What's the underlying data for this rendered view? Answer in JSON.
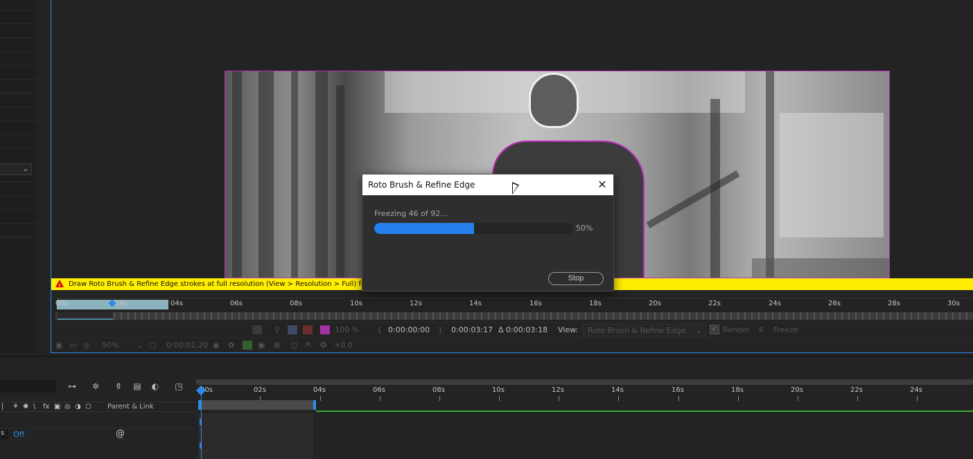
{
  "viewer": {
    "warning_text": "Draw Roto Brush & Refine Edge strokes at full resolution (View > Resolution > Full) for best results.",
    "ruler_labels": [
      "00s",
      "02s",
      "04s",
      "06s",
      "08s",
      "10s",
      "12s",
      "14s",
      "16s",
      "18s",
      "20s",
      "22s",
      "24s",
      "26s",
      "28s",
      "30s"
    ],
    "controls": {
      "opacity": "100 %",
      "time_start": "0:00:00:00",
      "time_end": "0:00:03:17",
      "time_delta": "Δ 0:00:03:18",
      "view_label": "View:",
      "view_value": "Roto Brush & Refine Edge",
      "render_label": "Render",
      "freeze_label": "Freeze"
    },
    "toolbar": {
      "zoom": "50%",
      "timecode": "0:00:01:20",
      "exposure": "+0.0"
    }
  },
  "dialog": {
    "title": "Roto Brush & Refine Edge",
    "progress_label": "Freezing 46 of 92...",
    "progress_percent": 50,
    "progress_text": "50%",
    "stop_label": "Stop"
  },
  "timeline": {
    "ruler_labels": [
      "00s",
      "02s",
      "04s",
      "06s",
      "08s",
      "10s",
      "12s",
      "14s",
      "16s",
      "18s",
      "20s",
      "22s",
      "24s"
    ],
    "parent_link_label": "Parent & Link",
    "layer_tag": "s",
    "layer_mode": "Off"
  },
  "colors": {
    "accent": "#2d8ceb",
    "warning": "#ffee00",
    "mask": "#c02cc0",
    "progress": "#2680eb"
  }
}
